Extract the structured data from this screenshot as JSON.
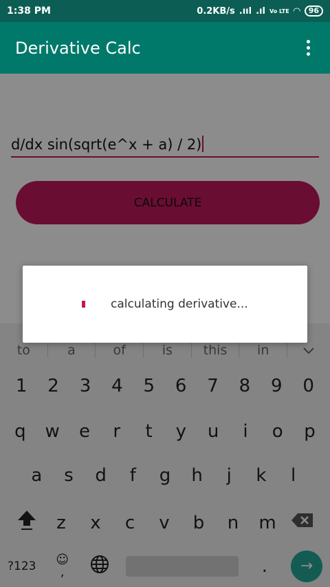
{
  "status": {
    "time": "1:38 PM",
    "network_speed": "0.2KB/s",
    "volte": "Vo LTE",
    "battery": "96"
  },
  "appbar": {
    "title": "Derivative Calc"
  },
  "main": {
    "expression": "d/dx sin(sqrt(e^x + a) / 2)",
    "calculate_label": "CALCULATE"
  },
  "dialog": {
    "message": "calculating derivative..."
  },
  "keyboard": {
    "suggestions": [
      "to",
      "a",
      "of",
      "is",
      "this",
      "in"
    ],
    "row1": [
      "1",
      "2",
      "3",
      "4",
      "5",
      "6",
      "7",
      "8",
      "9",
      "0"
    ],
    "row2": [
      "q",
      "w",
      "e",
      "r",
      "t",
      "y",
      "u",
      "i",
      "o",
      "p"
    ],
    "row3": [
      "a",
      "s",
      "d",
      "f",
      "g",
      "h",
      "j",
      "k",
      "l"
    ],
    "row4": [
      "z",
      "x",
      "c",
      "v",
      "b",
      "n",
      "m"
    ],
    "symbols_label": "?123",
    "comma_label": ",",
    "period_label": "."
  },
  "colors": {
    "primary": "#00796b",
    "primary_dark": "#0c5e54",
    "accent": "#c2185b"
  },
  "icons": [
    "signal-icon",
    "wifi-icon",
    "battery-icon",
    "overflow-menu-icon",
    "shift-icon",
    "backspace-icon",
    "emoji-icon",
    "globe-icon",
    "enter-icon",
    "chevron-down-icon"
  ]
}
